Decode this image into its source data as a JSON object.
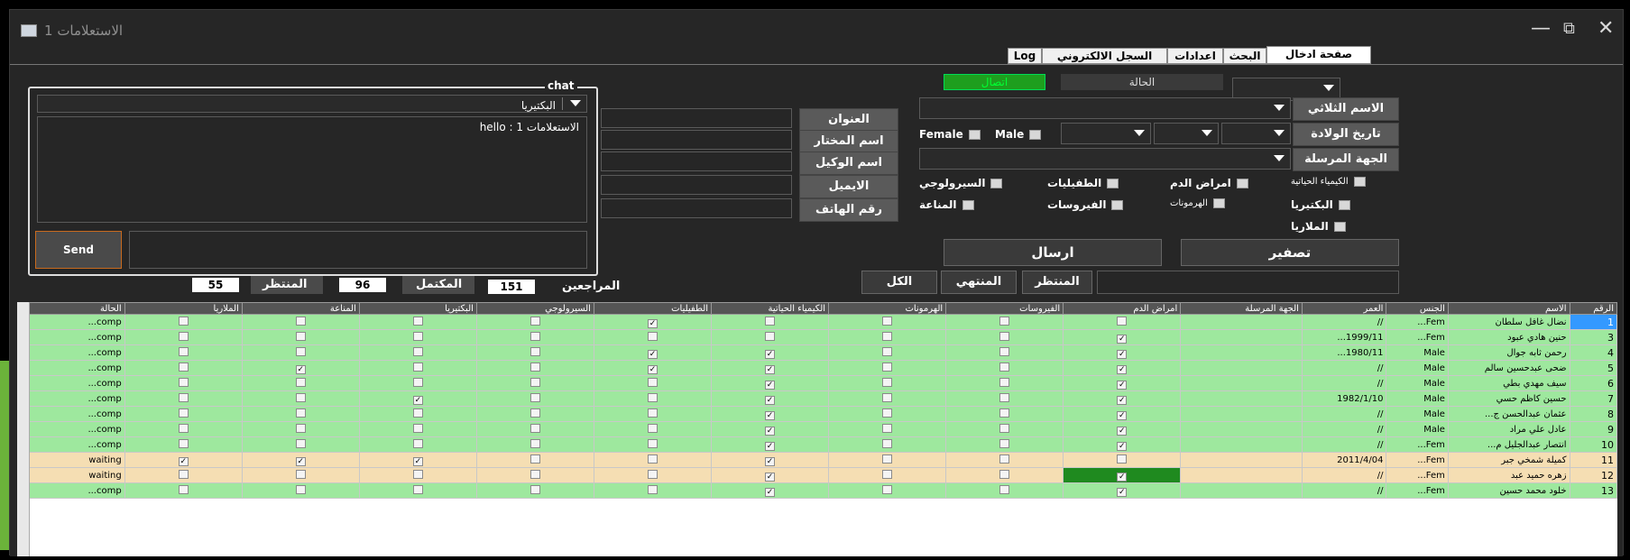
{
  "window": {
    "title": "الاستعلامات 1"
  },
  "tabs": [
    {
      "label": "صفحة ادخال الحقول"
    },
    {
      "label": "البحث"
    },
    {
      "label": "اعدادات"
    },
    {
      "label": "السجل الالكتروني"
    },
    {
      "label": "Log"
    }
  ],
  "status": {
    "label": "الحالة",
    "connection": "اتصال",
    "connection_color": "#1e9e1e"
  },
  "form": {
    "full_name": "الاسم الثلاثي",
    "birth_date": "تاريخ الولادة",
    "sender": "الجهة المرسلة",
    "male": "Male",
    "female": "Female",
    "address": "العنوان",
    "mukhtar": "اسم المختار",
    "agent": "اسم الوكيل",
    "email": "الايميل",
    "phone": "رقم الهاتف",
    "tests": {
      "chemistry": "الكيمياء الحياتية",
      "blood": "امراض الدم",
      "parasites": "الطفيليات",
      "serology": "السيرولوجي",
      "bacteria": "البكتيريا",
      "hormones": "الهرمونات",
      "viruses": "الفيروسات",
      "immunity": "المناعة",
      "malaria": "الملاريا"
    },
    "clear_btn": "تصفير",
    "send_btn": "ارسال"
  },
  "chat": {
    "legend": "chat",
    "recipient": "البكتيريا",
    "messages": "hello : 1 الاستعلامات",
    "send_label": "Send"
  },
  "counts": {
    "visitors_label": "المراجعين",
    "visitors": "151",
    "completed_label": "المكتمل",
    "completed": "96",
    "waiting_label": "المنتظر",
    "waiting": "55"
  },
  "filters": {
    "waiting": "المنتظر",
    "finished": "المنتهي",
    "all": "الكل"
  },
  "grid": {
    "headers": [
      "الرقم",
      "الاسم",
      "الجنس",
      "العمر",
      "الجهة المرسلة",
      "امراض الدم",
      "الفيروسات",
      "الهرمونات",
      "الكيمياء الحياتية",
      "الطفيليات",
      "السيرولوجي",
      "البكتيريا",
      "المناعة",
      "الملاريا",
      "الحالة"
    ],
    "rows": [
      {
        "n": "1",
        "name": "نضال غافل سلطان",
        "sex": "Fem...",
        "age": "//",
        "checks": [
          0,
          0,
          0,
          0,
          1,
          0,
          0,
          0,
          0
        ],
        "status": "comp...",
        "wait": false
      },
      {
        "n": "3",
        "name": "حنين هادي عبود",
        "sex": "Fem...",
        "age": "1999/11...",
        "checks": [
          1,
          0,
          0,
          0,
          0,
          0,
          0,
          0,
          0
        ],
        "status": "comp...",
        "wait": false
      },
      {
        "n": "4",
        "name": "رحمن ثابه جوال",
        "sex": "Male",
        "age": "1980/11...",
        "checks": [
          1,
          0,
          0,
          1,
          1,
          0,
          0,
          0,
          0
        ],
        "status": "comp...",
        "wait": false
      },
      {
        "n": "5",
        "name": "ضحى عبدحسين سالم",
        "sex": "Male",
        "age": "//",
        "checks": [
          1,
          0,
          0,
          1,
          1,
          0,
          0,
          1,
          0
        ],
        "status": "comp...",
        "wait": false
      },
      {
        "n": "6",
        "name": "سيف مهدي بطي",
        "sex": "Male",
        "age": "//",
        "checks": [
          1,
          0,
          0,
          1,
          0,
          0,
          0,
          0,
          0
        ],
        "status": "comp...",
        "wait": false
      },
      {
        "n": "7",
        "name": "حسين كاظم حسي",
        "sex": "Male",
        "age": "1982/1/10",
        "checks": [
          1,
          0,
          0,
          1,
          0,
          0,
          1,
          0,
          0
        ],
        "status": "comp...",
        "wait": false
      },
      {
        "n": "8",
        "name": "عثمان عبدالحسن ج...",
        "sex": "Male",
        "age": "//",
        "checks": [
          1,
          0,
          0,
          1,
          0,
          0,
          0,
          0,
          0
        ],
        "status": "comp...",
        "wait": false
      },
      {
        "n": "9",
        "name": "عادل علي مراد",
        "sex": "Male",
        "age": "//",
        "checks": [
          1,
          0,
          0,
          1,
          0,
          0,
          0,
          0,
          0
        ],
        "status": "comp...",
        "wait": false
      },
      {
        "n": "10",
        "name": "انتصار عبدالجليل م...",
        "sex": "Fem...",
        "age": "//",
        "checks": [
          1,
          0,
          0,
          1,
          0,
          0,
          0,
          0,
          0
        ],
        "status": "comp...",
        "wait": false
      },
      {
        "n": "11",
        "name": "كميلة شمخي جبر",
        "sex": "Fem...",
        "age": "2011/4/04",
        "checks": [
          0,
          0,
          0,
          1,
          0,
          0,
          1,
          1,
          1
        ],
        "status": "waiting",
        "wait": true
      },
      {
        "n": "12",
        "name": "زهره حميد عبد",
        "sex": "Fem...",
        "age": "//",
        "checks": [
          1,
          0,
          0,
          1,
          0,
          0,
          0,
          0,
          0
        ],
        "status": "waiting",
        "wait": true
      },
      {
        "n": "13",
        "name": "خلود محمد حسين",
        "sex": "Fem...",
        "age": "//",
        "checks": [
          1,
          0,
          0,
          1,
          0,
          0,
          0,
          0,
          0
        ],
        "status": "comp...",
        "wait": false
      }
    ]
  }
}
